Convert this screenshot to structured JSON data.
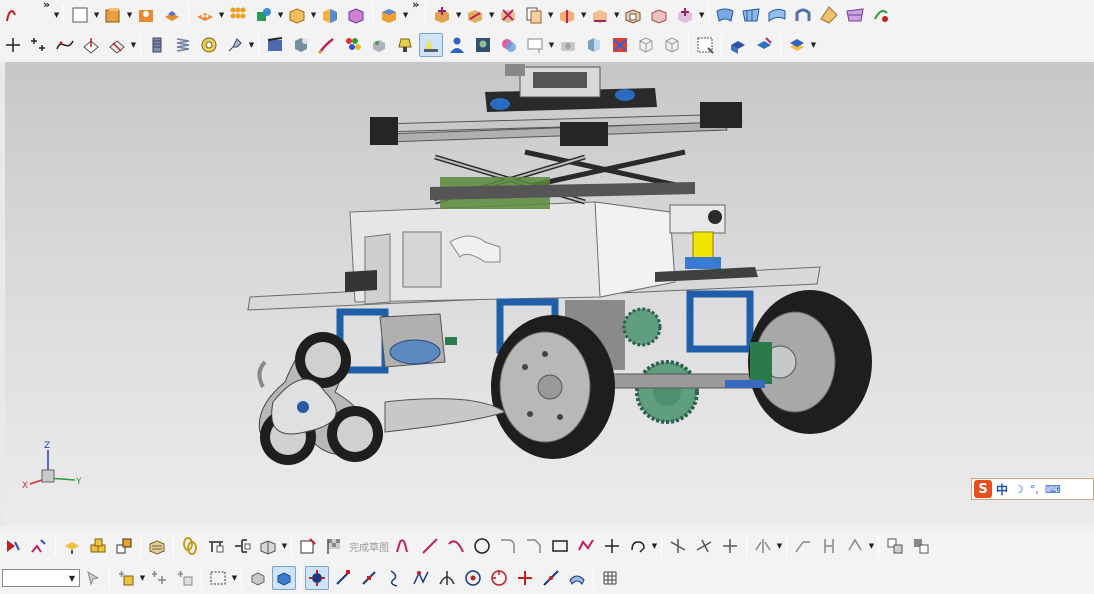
{
  "toolbars": {
    "row1": {
      "more_glyph": "»",
      "second_more_glyph": "»"
    },
    "row2": {},
    "sketch": {
      "finish_sketch_label": "完成草图"
    },
    "bottom": {
      "filter_select_value": "",
      "filter_select_arrow": "▼"
    }
  },
  "ime": {
    "logo": "S",
    "mode": "中",
    "moon": "☽",
    "punct": "°,",
    "keyboard": "⌨"
  },
  "axes": {
    "x": "X",
    "y": "Y",
    "z": "Z"
  },
  "colors": {
    "viewport_top": "#c7c7c9",
    "viewport_bottom": "#ececed",
    "axis_x": "#d23030",
    "axis_y": "#2a9a3a",
    "axis_z": "#2040c0",
    "frame_blue": "#1f5fa8",
    "gear_green": "#5f9f7f",
    "tire": "#1e1e1e",
    "yellow_part": "#f2e600"
  }
}
